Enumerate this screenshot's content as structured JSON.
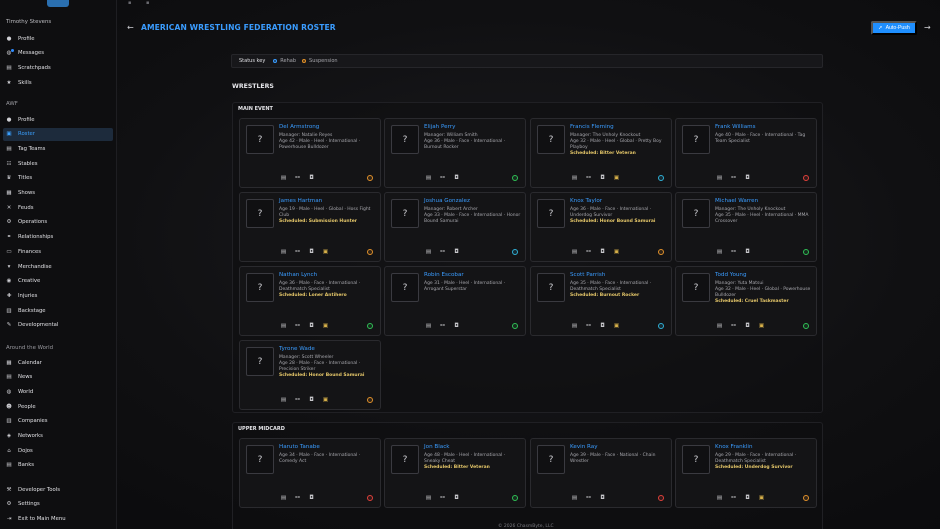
{
  "sidebar": {
    "user": "Timothy Stevens",
    "user_items": [
      {
        "label": "Profile",
        "icon": "user-icon",
        "glyph": "●"
      },
      {
        "label": "Messages",
        "icon": "chat-icon",
        "glyph": "◍",
        "badge": true
      },
      {
        "label": "Scratchpads",
        "icon": "note-icon",
        "glyph": "▤"
      },
      {
        "label": "Skills",
        "icon": "star-icon",
        "glyph": "★"
      }
    ],
    "org_label": "AWF",
    "org_items": [
      {
        "label": "Profile",
        "icon": "building-icon",
        "glyph": "●"
      },
      {
        "label": "Roster",
        "icon": "roster-icon",
        "glyph": "▣",
        "active": true
      },
      {
        "label": "Tag Teams",
        "icon": "tag-team-icon",
        "glyph": "▤"
      },
      {
        "label": "Stables",
        "icon": "group-icon",
        "glyph": "☷"
      },
      {
        "label": "Titles",
        "icon": "trophy-icon",
        "glyph": "♛"
      },
      {
        "label": "Shows",
        "icon": "calendar-icon",
        "glyph": "▦"
      },
      {
        "label": "Feuds",
        "icon": "versus-icon",
        "glyph": "✕"
      },
      {
        "label": "Operations",
        "icon": "gear-icon",
        "glyph": "⚙"
      },
      {
        "label": "Relationships",
        "icon": "link-icon",
        "glyph": "⚭"
      },
      {
        "label": "Finances",
        "icon": "money-icon",
        "glyph": "▭"
      },
      {
        "label": "Merchandise",
        "icon": "shirt-icon",
        "glyph": "▾"
      },
      {
        "label": "Creative",
        "icon": "bulb-icon",
        "glyph": "◉"
      },
      {
        "label": "Injuries",
        "icon": "medical-icon",
        "glyph": "✚"
      },
      {
        "label": "Backstage",
        "icon": "door-icon",
        "glyph": "▥"
      },
      {
        "label": "Developmental",
        "icon": "pencil-icon",
        "glyph": "✎"
      }
    ],
    "world_label": "Around the World",
    "world_items": [
      {
        "label": "Calendar",
        "icon": "calendar-icon",
        "glyph": "▦"
      },
      {
        "label": "News",
        "icon": "newspaper-icon",
        "glyph": "▤"
      },
      {
        "label": "World",
        "icon": "globe-icon",
        "glyph": "◍"
      },
      {
        "label": "People",
        "icon": "people-icon",
        "glyph": "☻"
      },
      {
        "label": "Companies",
        "icon": "company-icon",
        "glyph": "▥"
      },
      {
        "label": "Networks",
        "icon": "network-icon",
        "glyph": "◈"
      },
      {
        "label": "Dojos",
        "icon": "dojo-icon",
        "glyph": "⌂"
      },
      {
        "label": "Banks",
        "icon": "bank-icon",
        "glyph": "▤"
      }
    ],
    "bottom_items": [
      {
        "label": "Developer Tools",
        "icon": "tools-icon",
        "glyph": "⚒"
      },
      {
        "label": "Settings",
        "icon": "gear-icon",
        "glyph": "⚙"
      },
      {
        "label": "Exit to Main Menu",
        "icon": "exit-icon",
        "glyph": "⇥"
      }
    ]
  },
  "header": {
    "title": "AMERICAN WRESTLING FEDERATION ROSTER",
    "auto_push": "Auto-Push"
  },
  "status_key": {
    "label": "Status key",
    "items": [
      {
        "label": "Rehab",
        "color": "#3a9cff"
      },
      {
        "label": "Suspension",
        "color": "#e0902a"
      }
    ]
  },
  "section_title": "WRESTLERS",
  "status_colors": {
    "orange": "#e0902a",
    "green": "#2fbf55",
    "teal": "#2fb0d6",
    "red": "#e0403a"
  },
  "tiers": [
    {
      "title": "MAIN EVENT",
      "wrestlers": [
        {
          "name": "Del Armstrong",
          "lines": [
            "Manager: Natalie Reyes",
            "Age 42 · Male · Heel · International · Powerhouse Bulldozer"
          ],
          "scheduled": "",
          "status": "orange",
          "extra": false
        },
        {
          "name": "Elijah Perry",
          "lines": [
            "Manager: William Smith",
            "Age 36 · Male · Face · International · Burnout Rocker"
          ],
          "scheduled": "",
          "status": "green",
          "extra": false
        },
        {
          "name": "Francis Fleming",
          "lines": [
            "Manager: The Unholy Knockout",
            "Age 32 · Male · Heel · Global · Pretty Boy Playboy"
          ],
          "scheduled": "Scheduled: Bitter Veteran",
          "status": "teal",
          "extra": true
        },
        {
          "name": "Frank Williams",
          "lines": [
            "Age 40 · Male · Face · International · Tag Team Specialist"
          ],
          "scheduled": "",
          "status": "red",
          "extra": false
        },
        {
          "name": "James Hartman",
          "lines": [
            "Age 19 · Male · Heel · Global · Hoss Fight Club"
          ],
          "scheduled": "Scheduled: Submission Hunter",
          "status": "orange",
          "extra": true
        },
        {
          "name": "Joshua Gonzalez",
          "lines": [
            "Manager: Robert Archer",
            "Age 33 · Male · Face · International · Honor Bound Samurai"
          ],
          "scheduled": "",
          "status": "teal",
          "extra": false
        },
        {
          "name": "Knox Taylor",
          "lines": [
            "Age 36 · Male · Face · International · Underdog Survivor"
          ],
          "scheduled": "Scheduled: Honor Bound Samurai",
          "status": "orange",
          "extra": true
        },
        {
          "name": "Michael Warren",
          "lines": [
            "Manager: The Unholy Knockout",
            "Age 35 · Male · Heel · International · MMA Crossover"
          ],
          "scheduled": "",
          "status": "green",
          "extra": false
        },
        {
          "name": "Nathan Lynch",
          "lines": [
            "Age 36 · Male · Face · International · Deathmatch Specialist"
          ],
          "scheduled": "Scheduled: Loner Antihero",
          "status": "green",
          "extra": true
        },
        {
          "name": "Robin Escobar",
          "lines": [
            "Age 31 · Male · Heel · International · Arrogant Superstar"
          ],
          "scheduled": "",
          "status": "green",
          "extra": false
        },
        {
          "name": "Scott Parrish",
          "lines": [
            "Age 35 · Male · Face · International · Deathmatch Specialist"
          ],
          "scheduled": "Scheduled: Burnout Rocker",
          "status": "teal",
          "extra": true
        },
        {
          "name": "Todd Young",
          "lines": [
            "Manager: Yuta Matsui",
            "Age 32 · Male · Heel · Global · Powerhouse Bulldozer"
          ],
          "scheduled": "Scheduled: Cruel Taskmaster",
          "status": "green",
          "extra": true
        },
        {
          "name": "Tyrone Wade",
          "lines": [
            "Manager: Scott Wheeler",
            "Age 28 · Male · Face · International · Precision Striker"
          ],
          "scheduled": "Scheduled: Honor Bound Samurai",
          "status": "orange",
          "extra": true
        }
      ]
    },
    {
      "title": "UPPER MIDCARD",
      "wrestlers": [
        {
          "name": "Haruto Tanabe",
          "lines": [
            "Age 34 · Male · Face · International · Comedy Act"
          ],
          "scheduled": "",
          "status": "red",
          "extra": false
        },
        {
          "name": "Jon Black",
          "lines": [
            "Age 48 · Male · Heel · International · Sneaky Cheat"
          ],
          "scheduled": "Scheduled: Bitter Veteran",
          "status": "green",
          "extra": false
        },
        {
          "name": "Kevin Ray",
          "lines": [
            "Age 39 · Male · Face · National · Chain Wrestler"
          ],
          "scheduled": "",
          "status": "red",
          "extra": false
        },
        {
          "name": "Knox Franklin",
          "lines": [
            "Age 29 · Male · Face · International · Deathmatch Specialist"
          ],
          "scheduled": "Scheduled: Underdog Survivor",
          "status": "orange",
          "extra": true
        }
      ]
    }
  ],
  "footer": "© 2026 ChasmByte, LLC"
}
